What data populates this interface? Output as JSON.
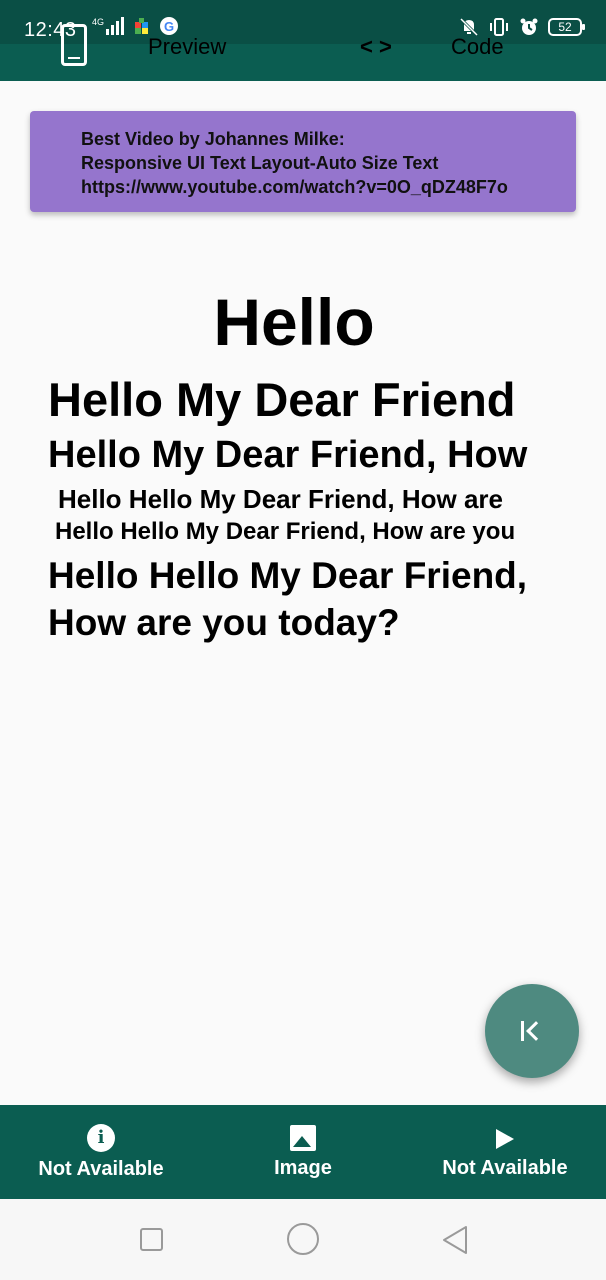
{
  "status_bar": {
    "time": "12:43",
    "network": "4G",
    "battery": "52"
  },
  "app_bar": {
    "preview_label": "Preview",
    "code_label": "Code"
  },
  "info_card": {
    "line1": "Best Video by Johannes Milke:",
    "line2": "Responsive UI Text Layout-Auto Size Text",
    "line3": "https://www.youtube.com/watch?v=0O_qDZ48F7o",
    "background_color": "#9575cd"
  },
  "content": {
    "text1": "Hello",
    "text2": "Hello My Dear Friend",
    "text3": "Hello My Dear Friend, How",
    "text4": "Hello Hello My Dear Friend, How are",
    "text5": "Hello Hello My Dear Friend, How are you",
    "text6": "Hello Hello My Dear Friend, How are you today?"
  },
  "fab": {
    "icon": "first-page-icon"
  },
  "bottom_nav": {
    "items": [
      {
        "label": "Not Available",
        "icon": "info-icon"
      },
      {
        "label": "Image",
        "icon": "image-icon"
      },
      {
        "label": "Not Available",
        "icon": "play-icon"
      }
    ]
  },
  "colors": {
    "primary": "#0b5d51",
    "status": "#0a4f45",
    "fab": "#4e8a80"
  }
}
